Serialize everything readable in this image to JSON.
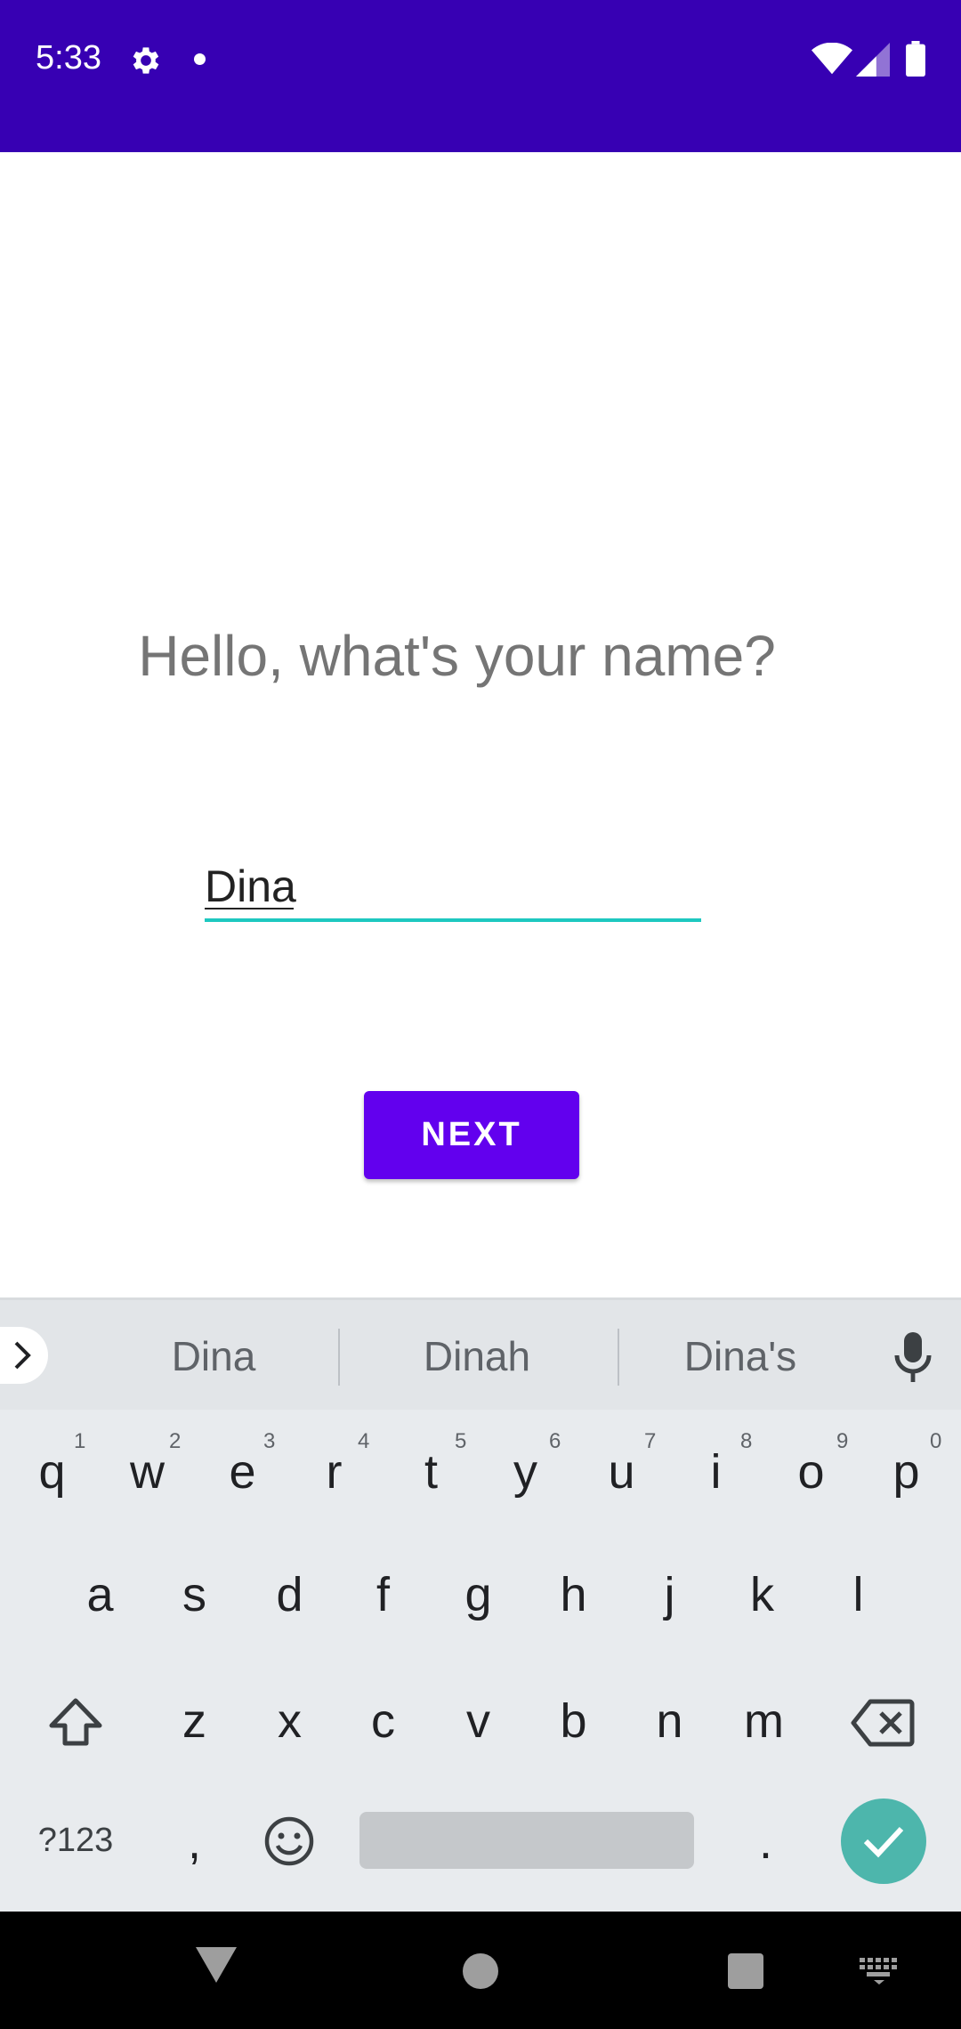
{
  "status_bar": {
    "time": "5:33",
    "background": "#3700b3",
    "icons": [
      "gear-icon",
      "notification-dot-icon",
      "wifi-icon",
      "signal-icon",
      "battery-icon"
    ]
  },
  "screen": {
    "prompt": "Hello, what's your name?",
    "name_input_value": "Dina",
    "next_label": "NEXT",
    "accent_color": "#6200ee",
    "input_underline_color": "#1ec8c0"
  },
  "keyboard": {
    "suggestions": [
      "Dina",
      "Dinah",
      "Dina's"
    ],
    "row1": [
      "q",
      "w",
      "e",
      "r",
      "t",
      "y",
      "u",
      "i",
      "o",
      "p"
    ],
    "row1_hints": [
      "1",
      "2",
      "3",
      "4",
      "5",
      "6",
      "7",
      "8",
      "9",
      "0"
    ],
    "row2": [
      "a",
      "s",
      "d",
      "f",
      "g",
      "h",
      "j",
      "k",
      "l"
    ],
    "row3": [
      "z",
      "x",
      "c",
      "v",
      "b",
      "n",
      "m"
    ],
    "symbols_label": "?123",
    "comma": ",",
    "period": ".",
    "enter_color": "#4db6ac"
  },
  "nav_bar": {
    "icons": [
      "back-icon",
      "home-icon",
      "recents-icon",
      "keyboard-switch-icon"
    ]
  }
}
